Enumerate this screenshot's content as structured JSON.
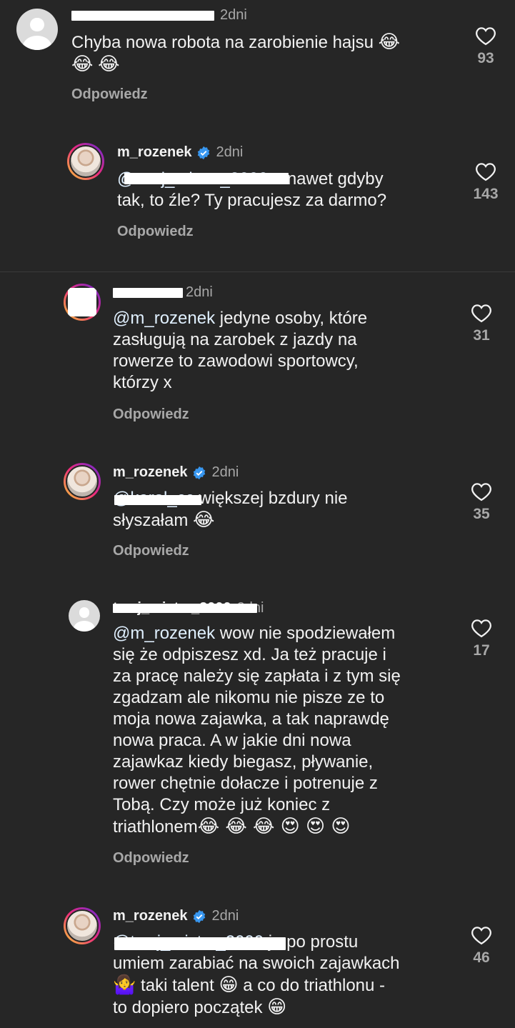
{
  "comments": [
    {
      "username": "",
      "time": "2dni",
      "text": "Chyba nowa robota na zarobienie hajsu 😂 😂 😂",
      "text_line1": "Chyba nowa robota na zarobienie hajsu",
      "emoji": "😂",
      "reply": "Odpowiedz",
      "likes": "93"
    },
    {
      "username": "m_rozenek",
      "time": "2dni",
      "mention": "@twoj_mistrz_2000",
      "text_line1": "a nawet gdyby",
      "text_line2": "tak, to źle? Ty pracujesz za darmo?",
      "reply": "Odpowiedz",
      "likes": "143"
    },
    {
      "username": "",
      "time": "2dni",
      "mention": "@m_rozenek",
      "text_line1": "jedyne osoby, które",
      "text_line2": "zasługują na zarobek z jazdy na",
      "text_line3": "rowerze to zawodowi sportowcy,",
      "text_line4": "którzy x",
      "reply": "Odpowiedz",
      "likes": "31"
    },
    {
      "username": "m_rozenek",
      "time": "2dni",
      "mention": "@karol_cc",
      "text_line1": "większej bzdury nie",
      "text_line2": "słyszałam",
      "emoji": "😂",
      "reply": "Odpowiedz",
      "likes": "35"
    },
    {
      "username": "twoj_mistrz_2000",
      "time": "2dni",
      "mention": "@m_rozenek",
      "lines": [
        "wow nie spodziewałem",
        "się że odpiszesz xd. Ja też pracuje i",
        "za pracę należy się zapłata i z tym się",
        "zgadzam ale nikomu nie pisze ze to",
        "moja nowa zajawka, a tak naprawdę",
        "nowa praca. A w jakie dni nowa",
        "zajawkaz kiedy biegasz, pływanie,",
        "rower chętnie dołacze i potrenuje z",
        "Tobą. Czy może już koniec z",
        "triathlonem"
      ],
      "emojis": "😂 😂 😂 😍 😍 😍",
      "reply": "Odpowiedz",
      "likes": "17"
    },
    {
      "username": "m_rozenek",
      "time": "2dni",
      "mention": "@twoj_mistrz_2000",
      "text_line1": "ja po prostu",
      "text_line2": "umiem zarabiać na swoich zajawkach",
      "emoji_shrug": "🤷‍♀️",
      "text_line3a": "taki talent",
      "emoji_grin": "😁",
      "text_line3b": "a co do triathlonu -",
      "text_line4": "to dopiero początek",
      "likes": "46"
    }
  ],
  "colors": {
    "background": "#262626",
    "text": "#f2f2f2",
    "secondary": "#a8a8a8",
    "verified": "#3897f0"
  }
}
